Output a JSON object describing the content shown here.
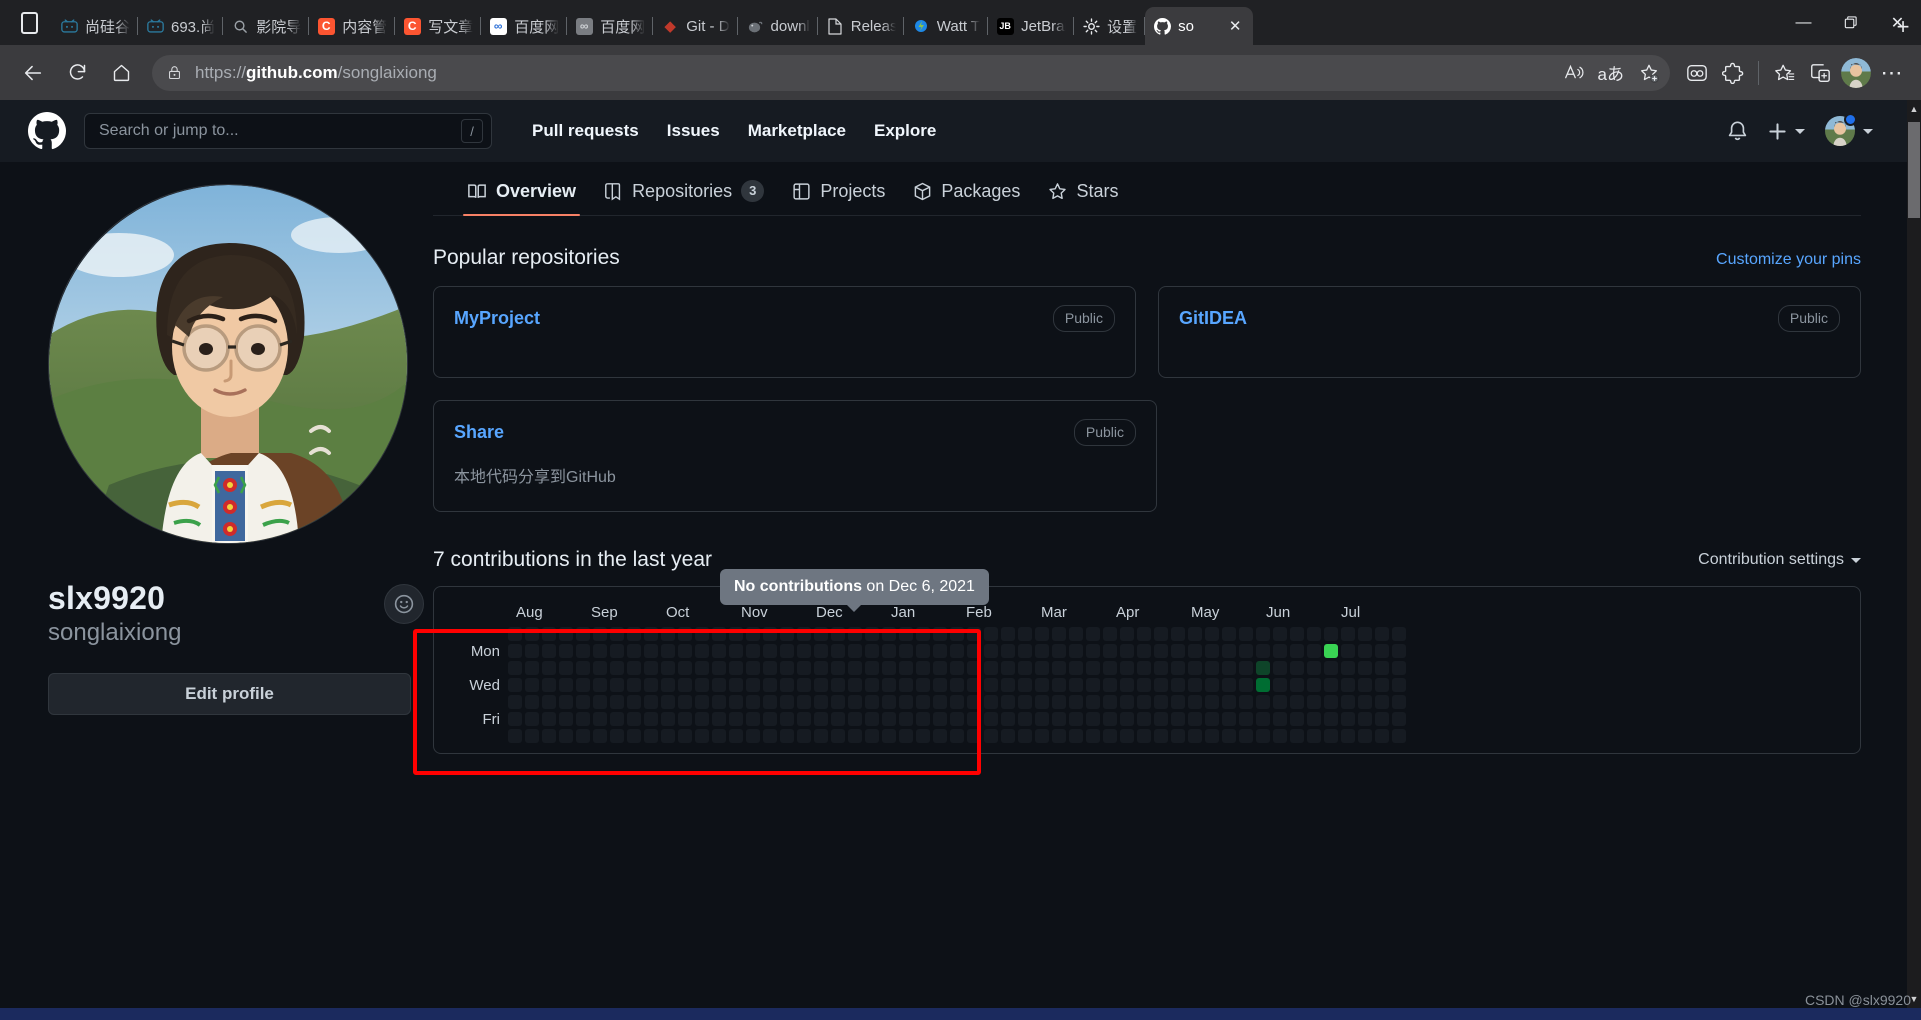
{
  "browser": {
    "tablist_icon": "tab-list-icon",
    "tabs": [
      {
        "label": "尚硅谷",
        "icon": "bilibili-icon",
        "color": "#2b7a9e",
        "text": "凹"
      },
      {
        "label": "693.尚",
        "icon": "bilibili-icon",
        "color": "#2b7a9e",
        "text": "凹"
      },
      {
        "label": "影院导",
        "icon": "search-icon",
        "color": "",
        "text": "⌕"
      },
      {
        "label": "内容管",
        "icon": "csdn-icon",
        "color": "#fc5531",
        "text": "C"
      },
      {
        "label": "写文章",
        "icon": "csdn-icon",
        "color": "#fc5531",
        "text": "C"
      },
      {
        "label": "百度网",
        "icon": "baidu-icon",
        "color": "#ffffff",
        "text": "∞"
      },
      {
        "label": "百度网",
        "icon": "baidu-grey-icon",
        "color": "#7a7d82",
        "text": "∞"
      },
      {
        "label": "Git - D",
        "icon": "git-icon",
        "color": "#c0392b",
        "text": "◈"
      },
      {
        "label": "downl",
        "icon": "elephant-icon",
        "color": "",
        "text": "🐘"
      },
      {
        "label": "Releas",
        "icon": "document-icon",
        "color": "",
        "text": "🗎"
      },
      {
        "label": "Watt T",
        "icon": "watt-icon",
        "color": "",
        "text": "⚙"
      },
      {
        "label": "JetBrai",
        "icon": "jetbrains-icon",
        "color": "#000000",
        "text": "JB"
      },
      {
        "label": "设置",
        "icon": "gear-icon",
        "color": "",
        "text": "⚙"
      },
      {
        "label": "so",
        "icon": "github-icon",
        "color": "",
        "text": "◉",
        "active": true
      }
    ],
    "new_tab": "+",
    "window_controls": {
      "minimize": "—",
      "restore": "❐",
      "close": "✕"
    },
    "nav": {
      "back": "←",
      "reload": "⟳",
      "home": "⌂"
    },
    "url_prefix": "https://",
    "url_domain": "github.com",
    "url_path": "/songlaixiong",
    "url_full": "https://github.com/songlaixiong",
    "toolbar_icons": [
      "read-aloud-icon",
      "translate-icon",
      "add-favorite-icon",
      "collections-icon",
      "extensions-icon",
      "favorites-icon",
      "split-screen-icon",
      "profile-avatar-icon",
      "settings-more-icon"
    ]
  },
  "github": {
    "header": {
      "logo": "github-mark-icon",
      "search_placeholder": "Search or jump to...",
      "search_shortcut": "/",
      "nav": [
        "Pull requests",
        "Issues",
        "Marketplace",
        "Explore"
      ],
      "notification_icon": "bell-icon",
      "create_new_icon": "plus-icon",
      "avatar_icon": "user-avatar"
    },
    "profile": {
      "name": "slx9920",
      "login": "songlaixiong",
      "edit_button": "Edit profile",
      "status_icon": "smiley-icon"
    },
    "tabs": [
      {
        "label": "Overview",
        "icon": "book-icon",
        "selected": true,
        "count": null
      },
      {
        "label": "Repositories",
        "icon": "repo-icon",
        "selected": false,
        "count": "3"
      },
      {
        "label": "Projects",
        "icon": "project-icon",
        "selected": false,
        "count": null
      },
      {
        "label": "Packages",
        "icon": "package-icon",
        "selected": false,
        "count": null
      },
      {
        "label": "Stars",
        "icon": "star-icon",
        "selected": false,
        "count": null
      }
    ],
    "popular": {
      "title": "Popular repositories",
      "customize_link": "Customize your pins",
      "repos": [
        {
          "name": "MyProject",
          "visibility": "Public",
          "description": ""
        },
        {
          "name": "GitIDEA",
          "visibility": "Public",
          "description": ""
        },
        {
          "name": "Share",
          "visibility": "Public",
          "description": "本地代码分享到GitHub",
          "highlighted": true
        }
      ]
    },
    "contributions": {
      "title": "7 contributions in the last year",
      "settings_label": "Contribution settings",
      "settings_caret": "▾",
      "months": [
        "Aug",
        "Sep",
        "Oct",
        "Nov",
        "Dec",
        "Jan",
        "Feb",
        "Mar",
        "Apr",
        "May",
        "Jun",
        "Jul"
      ],
      "day_labels": [
        "Mon",
        "Wed",
        "Fri"
      ],
      "tooltip": {
        "bold": "No contributions",
        "rest": " on Dec 6, 2021"
      },
      "levels": {
        "l0": "#161b22",
        "l1": "#0e4429",
        "l2": "#006d32",
        "l3": "#26a641",
        "l4": "#39d353"
      },
      "active_cells": [
        {
          "week": 48,
          "day": 1,
          "level": 4
        },
        {
          "week": 44,
          "day": 2,
          "level": 1
        },
        {
          "week": 44,
          "day": 3,
          "level": 2
        }
      ]
    }
  },
  "watermark": "CSDN @slx9920"
}
